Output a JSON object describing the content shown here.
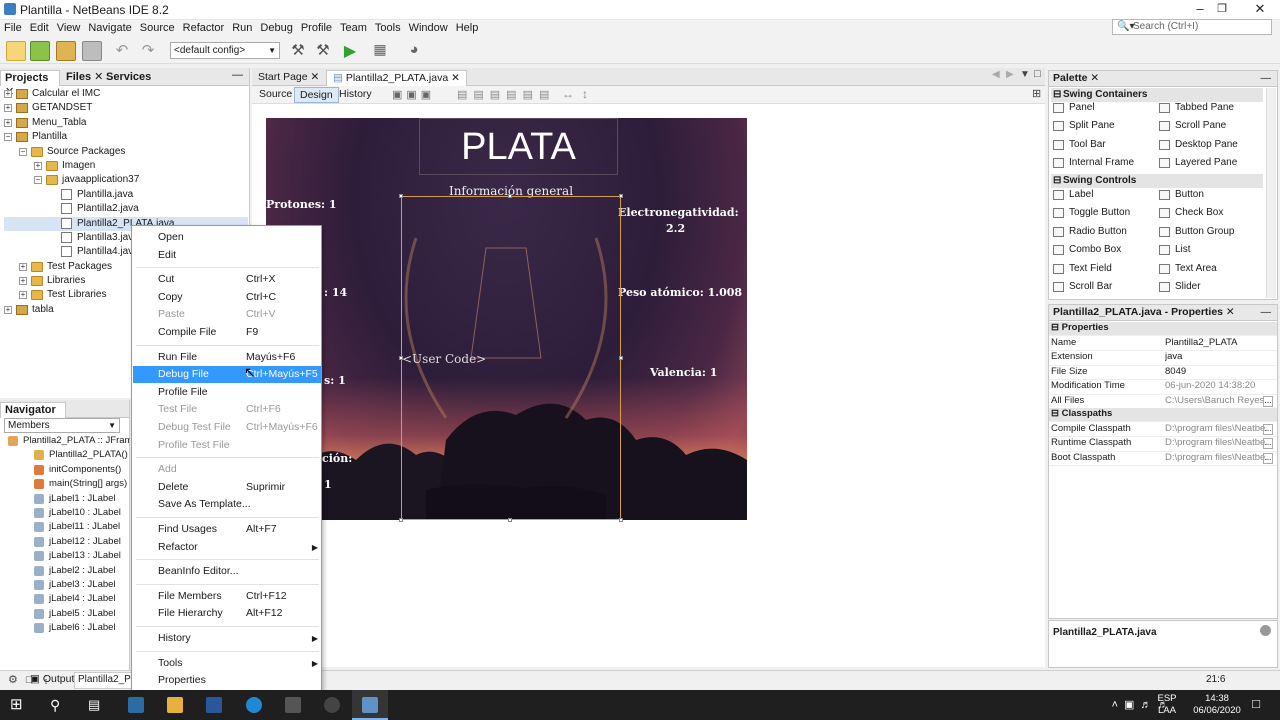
{
  "window": {
    "title": "Plantilla - NetBeans IDE 8.2"
  },
  "menubar": [
    "File",
    "Edit",
    "View",
    "Navigate",
    "Source",
    "Refactor",
    "Run",
    "Debug",
    "Profile",
    "Team",
    "Tools",
    "Window",
    "Help"
  ],
  "search": {
    "placeholder": "Search (Ctrl+I)"
  },
  "toolbar": {
    "config": "<default config>"
  },
  "projects_panel": {
    "tabs": [
      "Projects",
      "Files",
      "Services"
    ],
    "tree": [
      {
        "label": "Calcular el IMC",
        "indent": 0,
        "icon": "project"
      },
      {
        "label": "GETANDSET",
        "indent": 0,
        "icon": "project"
      },
      {
        "label": "Menu_Tabla",
        "indent": 0,
        "icon": "project"
      },
      {
        "label": "Plantilla",
        "indent": 0,
        "icon": "project"
      },
      {
        "label": "Source Packages",
        "indent": 1,
        "icon": "folder"
      },
      {
        "label": "Imagen",
        "indent": 2,
        "icon": "folder"
      },
      {
        "label": "javaapplication37",
        "indent": 2,
        "icon": "folder"
      },
      {
        "label": "Plantilla.java",
        "indent": 3,
        "icon": "java"
      },
      {
        "label": "Plantilla2.java",
        "indent": 3,
        "icon": "java"
      },
      {
        "label": "Plantilla2_PLATA.java",
        "indent": 3,
        "icon": "java"
      },
      {
        "label": "Plantilla3.java",
        "indent": 3,
        "icon": "java"
      },
      {
        "label": "Plantilla4.java",
        "indent": 3,
        "icon": "java"
      },
      {
        "label": "Test Packages",
        "indent": 1,
        "icon": "folder"
      },
      {
        "label": "Libraries",
        "indent": 1,
        "icon": "folder"
      },
      {
        "label": "Test Libraries",
        "indent": 1,
        "icon": "folder"
      },
      {
        "label": "tabla",
        "indent": 0,
        "icon": "project"
      }
    ]
  },
  "navigator": {
    "title": "Navigator",
    "filter": "Members",
    "items": [
      {
        "name": "Plantilla2_PLATA :: JFrame",
        "type": "class"
      },
      {
        "name": "Plantilla2_PLATA()",
        "type": "ctor"
      },
      {
        "name": "initComponents()",
        "type": "method"
      },
      {
        "name": "main(String[] args)",
        "type": "method"
      },
      {
        "name": "jLabel1 : JLabel",
        "type": "field"
      },
      {
        "name": "jLabel10 : JLabel",
        "type": "field"
      },
      {
        "name": "jLabel11 : JLabel",
        "type": "field"
      },
      {
        "name": "jLabel12 : JLabel",
        "type": "field"
      },
      {
        "name": "jLabel13 : JLabel",
        "type": "field"
      },
      {
        "name": "jLabel2 : JLabel",
        "type": "field"
      },
      {
        "name": "jLabel3 : JLabel",
        "type": "field"
      },
      {
        "name": "jLabel4 : JLabel",
        "type": "field"
      },
      {
        "name": "jLabel5 : JLabel",
        "type": "field"
      },
      {
        "name": "jLabel6 : JLabel",
        "type": "field"
      }
    ]
  },
  "editor": {
    "tabs": [
      "Start Page",
      "Plantilla2_PLATA.java"
    ],
    "subtabs": [
      "Source",
      "Design",
      "History"
    ],
    "form": {
      "title": "PLATA",
      "info": "Información general",
      "protones": "Protones: 1",
      "label2": ": 14",
      "label3": "s: 1",
      "label4": "ción:",
      "label5": "1",
      "electroneg": "Electronegatividad:",
      "electroneg_val": "2.2",
      "peso": "Peso atómico: 1.008",
      "valencia": "Valencia: 1",
      "user_code": "<User Code>"
    }
  },
  "palette": {
    "title": "Palette",
    "containers_title": "Swing Containers",
    "containers": [
      "Panel",
      "Tabbed Pane",
      "Split Pane",
      "Scroll Pane",
      "Tool Bar",
      "Desktop Pane",
      "Internal Frame",
      "Layered Pane"
    ],
    "controls_title": "Swing Controls",
    "controls": [
      "Label",
      "Button",
      "Toggle Button",
      "Check Box",
      "Radio Button",
      "Button Group",
      "Combo Box",
      "List",
      "Text Field",
      "Text Area",
      "Scroll Bar",
      "Slider"
    ]
  },
  "properties": {
    "title": "Plantilla2_PLATA.java - Properties",
    "sections": {
      "props": "Properties",
      "classpaths": "Classpaths"
    },
    "rows": [
      {
        "key": "Name",
        "value": "Plantilla2_PLATA"
      },
      {
        "key": "Extension",
        "value": "java"
      },
      {
        "key": "File Size",
        "value": "8049"
      },
      {
        "key": "Modification Time",
        "value": "06-jun-2020 14:38:20"
      },
      {
        "key": "All Files",
        "value": "C:\\Users\\Baruch Reyes..."
      }
    ],
    "classpath_rows": [
      {
        "key": "Compile Classpath",
        "value": "D:\\program files\\Neatbe..."
      },
      {
        "key": "Runtime Classpath",
        "value": "D:\\program files\\Neatbe..."
      },
      {
        "key": "Boot Classpath",
        "value": "D:\\program files\\Neatbe..."
      }
    ],
    "footer": "Plantilla2_PLATA.java"
  },
  "context_menu": [
    {
      "label": "Open",
      "shortcut": "",
      "state": "normal"
    },
    {
      "label": "Edit",
      "shortcut": "",
      "state": "normal"
    },
    {
      "sep": true
    },
    {
      "label": "Cut",
      "shortcut": "Ctrl+X",
      "state": "normal"
    },
    {
      "label": "Copy",
      "shortcut": "Ctrl+C",
      "state": "normal"
    },
    {
      "label": "Paste",
      "shortcut": "Ctrl+V",
      "state": "disabled"
    },
    {
      "label": "Compile File",
      "shortcut": "F9",
      "state": "normal"
    },
    {
      "sep": true
    },
    {
      "label": "Run File",
      "shortcut": "Mayús+F6",
      "state": "normal"
    },
    {
      "label": "Debug File",
      "shortcut": "Ctrl+Mayús+F5",
      "state": "highlighted"
    },
    {
      "label": "Profile File",
      "shortcut": "",
      "state": "normal"
    },
    {
      "label": "Test File",
      "shortcut": "Ctrl+F6",
      "state": "disabled"
    },
    {
      "label": "Debug Test File",
      "shortcut": "Ctrl+Mayús+F6",
      "state": "disabled"
    },
    {
      "label": "Profile Test File",
      "shortcut": "",
      "state": "disabled"
    },
    {
      "sep": true
    },
    {
      "label": "Add",
      "shortcut": "",
      "state": "disabled"
    },
    {
      "label": "Delete",
      "shortcut": "Suprimir",
      "state": "normal"
    },
    {
      "label": "Save As Template...",
      "shortcut": "",
      "state": "normal"
    },
    {
      "sep": true
    },
    {
      "label": "Find Usages",
      "shortcut": "Alt+F7",
      "state": "normal"
    },
    {
      "label": "Refactor",
      "shortcut": "",
      "state": "submenu"
    },
    {
      "sep": true
    },
    {
      "label": "BeanInfo Editor...",
      "shortcut": "",
      "state": "normal"
    },
    {
      "sep": true
    },
    {
      "label": "File Members",
      "shortcut": "Ctrl+F12",
      "state": "normal"
    },
    {
      "label": "File Hierarchy",
      "shortcut": "Alt+F12",
      "state": "normal"
    },
    {
      "sep": true
    },
    {
      "label": "History",
      "shortcut": "",
      "state": "submenu"
    },
    {
      "sep": true
    },
    {
      "label": "Tools",
      "shortcut": "",
      "state": "submenu"
    },
    {
      "label": "Properties",
      "shortcut": "",
      "state": "normal"
    }
  ],
  "statusbar": {
    "output_tab": "Output",
    "file_tab": "Plantilla2_PLATA",
    "position": "21:6"
  },
  "taskbar": {
    "lang": "ESP",
    "lang2": "LAA",
    "time": "14:38",
    "date": "06/06/2020"
  }
}
